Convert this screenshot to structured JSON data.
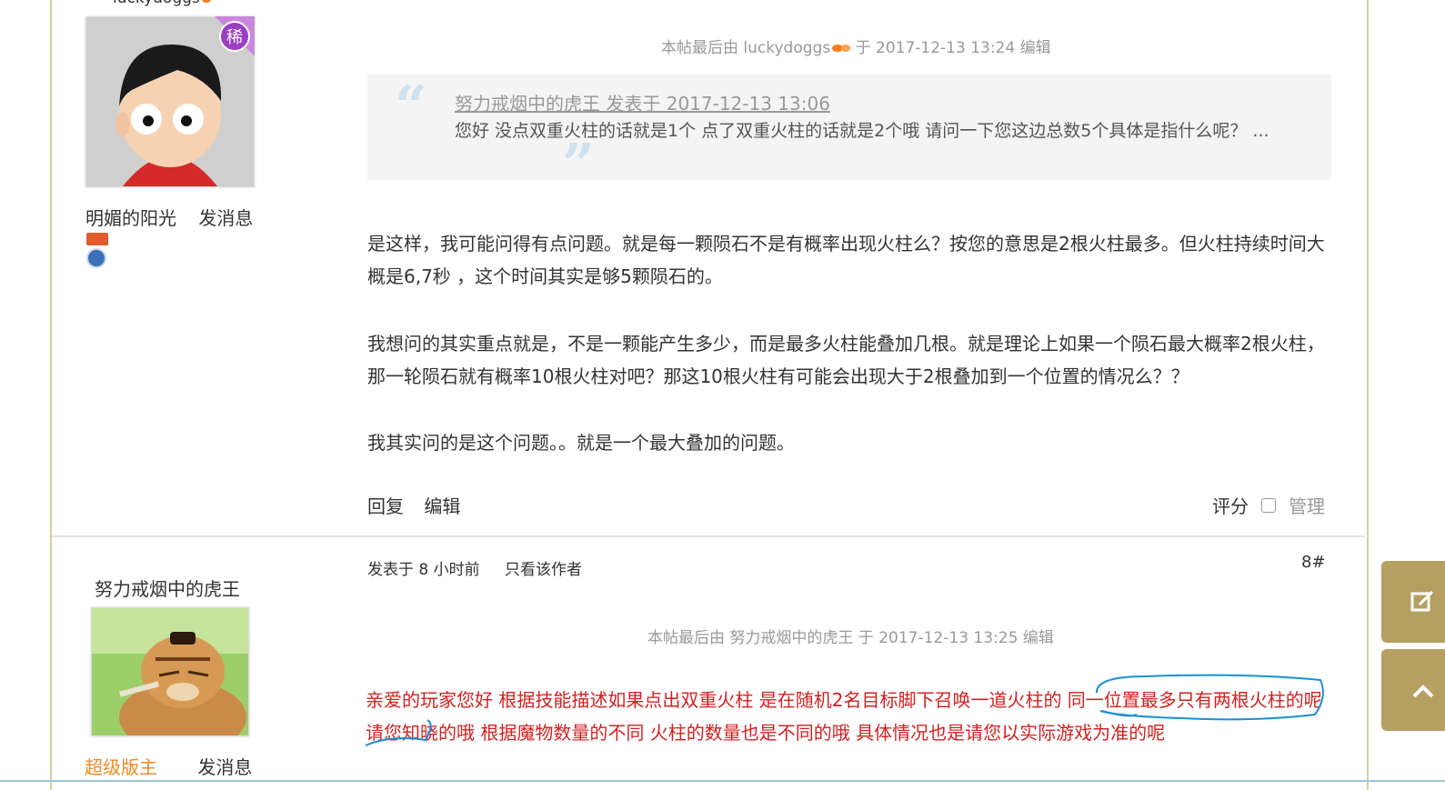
{
  "post1": {
    "author_top_name": "luckydoggs",
    "rare_badge_char": "稀",
    "author_name": "明媚的阳光",
    "send_msg": "发消息",
    "edit_note": {
      "prefix": "本帖最后由",
      "user": "luckydoggs",
      "rest": "于 2017-12-13 13:24 编辑"
    },
    "quote": {
      "head": "努力戒烟中的虎王 发表于 2017-12-13 13:06",
      "body": "您好 没点双重火柱的话就是1个  点了双重火柱的话就是2个哦 请问一下您这边总数5个具体是指什么呢？ ..."
    },
    "paragraphs": [
      "是这样，我可能问得有点问题。就是每一颗陨石不是有概率出现火柱么？按您的意思是2根火柱最多。但火柱持续时间大概是6,7秒 ，这个时间其实是够5颗陨石的。",
      "我想问的其实重点就是，不是一颗能产生多少，而是最多火柱能叠加几根。就是理论上如果一个陨石最大概率2根火柱，那一轮陨石就有概率10根火柱对吧？那这10根火柱有可能会出现大于2根叠加到一个位置的情况么？？",
      "我其实问的是这个问题。。就是一个最大叠加的问题。"
    ],
    "actions": {
      "reply": "回复",
      "edit": "编辑",
      "rate": "评分",
      "manage": "管理"
    }
  },
  "post2": {
    "author_name": "努力戒烟中的虎王",
    "role": "超级版主",
    "send_msg": "发消息",
    "posted_at": "发表于 8 小时前",
    "only_author": "只看该作者",
    "floor": "8#",
    "edit_note": "本帖最后由 努力戒烟中的虎王 于 2017-12-13 13:25 编辑",
    "reply_text": "亲爱的玩家您好  根据技能描述如果点出双重火柱 是在随机2名目标脚下召唤一道火柱的  同一位置最多只有两根火柱的呢 请您知晓的哦 根据魔物数量的不同  火柱的数量也是不同的哦 具体情况也是请您以实际游戏为准的呢"
  },
  "colors": {
    "reply_red": "#d42020",
    "annotation_blue": "#1a8fd6",
    "gold_border": "#d8cfa6",
    "float_btn": "#b5a062",
    "role_orange": "#f08a24"
  },
  "float_buttons": [
    "edit-icon",
    "scroll-top-icon"
  ]
}
